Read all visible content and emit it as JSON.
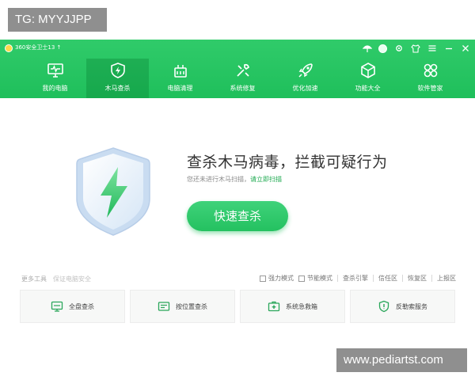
{
  "watermark": {
    "top_tag": "TG: MYYJJPP",
    "bottom_tag": "www.pediartst.com"
  },
  "app": {
    "title": "360安全卫士13 ↑"
  },
  "window_controls": [
    "skin-icon",
    "avatar",
    "gear-icon",
    "shirt-icon",
    "menu-icon",
    "minimize-icon",
    "close-icon"
  ],
  "nav": [
    {
      "id": "computer-checkup",
      "label": "我的电脑",
      "icon": "monitor-icon",
      "active": false
    },
    {
      "id": "trojan-scan",
      "label": "木马查杀",
      "icon": "shield-bolt-icon",
      "active": true
    },
    {
      "id": "pc-cleanup",
      "label": "电脑清理",
      "icon": "broom-icon",
      "active": false
    },
    {
      "id": "system-repair",
      "label": "系统修复",
      "icon": "wrench-icon",
      "active": false
    },
    {
      "id": "speed-up",
      "label": "优化加速",
      "icon": "rocket-icon",
      "active": false
    },
    {
      "id": "function-suite",
      "label": "功能大全",
      "icon": "box-icon",
      "active": false
    },
    {
      "id": "software-manager",
      "label": "软件管家",
      "icon": "puzzle-icon",
      "active": false
    }
  ],
  "main": {
    "headline": "查杀木马病毒，拦截可疑行为",
    "subline_prefix": "您还未进行木马扫描，",
    "subline_link": "请立即扫描",
    "scan_button": "快速查杀"
  },
  "tools": {
    "left_label": "更多工具",
    "left_hint": "保证电脑安全",
    "options": [
      {
        "label": "强力模式",
        "checked": false
      },
      {
        "label": "节能模式",
        "checked": false
      }
    ],
    "links": [
      "查杀引擎",
      "信任区",
      "恢复区",
      "上报区"
    ]
  },
  "scan_modes": [
    {
      "label": "全盘查杀",
      "icon": "disk-scan-icon"
    },
    {
      "label": "按位置查杀",
      "icon": "folder-scan-icon"
    },
    {
      "label": "系统急救箱",
      "icon": "first-aid-icon"
    },
    {
      "label": "反勒索服务",
      "icon": "anti-ransom-shield-icon"
    }
  ],
  "colors": {
    "brand_green": "#24c160",
    "header_top": "#30cb6a",
    "text_dark": "#333333",
    "link_green": "#1eaa50"
  }
}
